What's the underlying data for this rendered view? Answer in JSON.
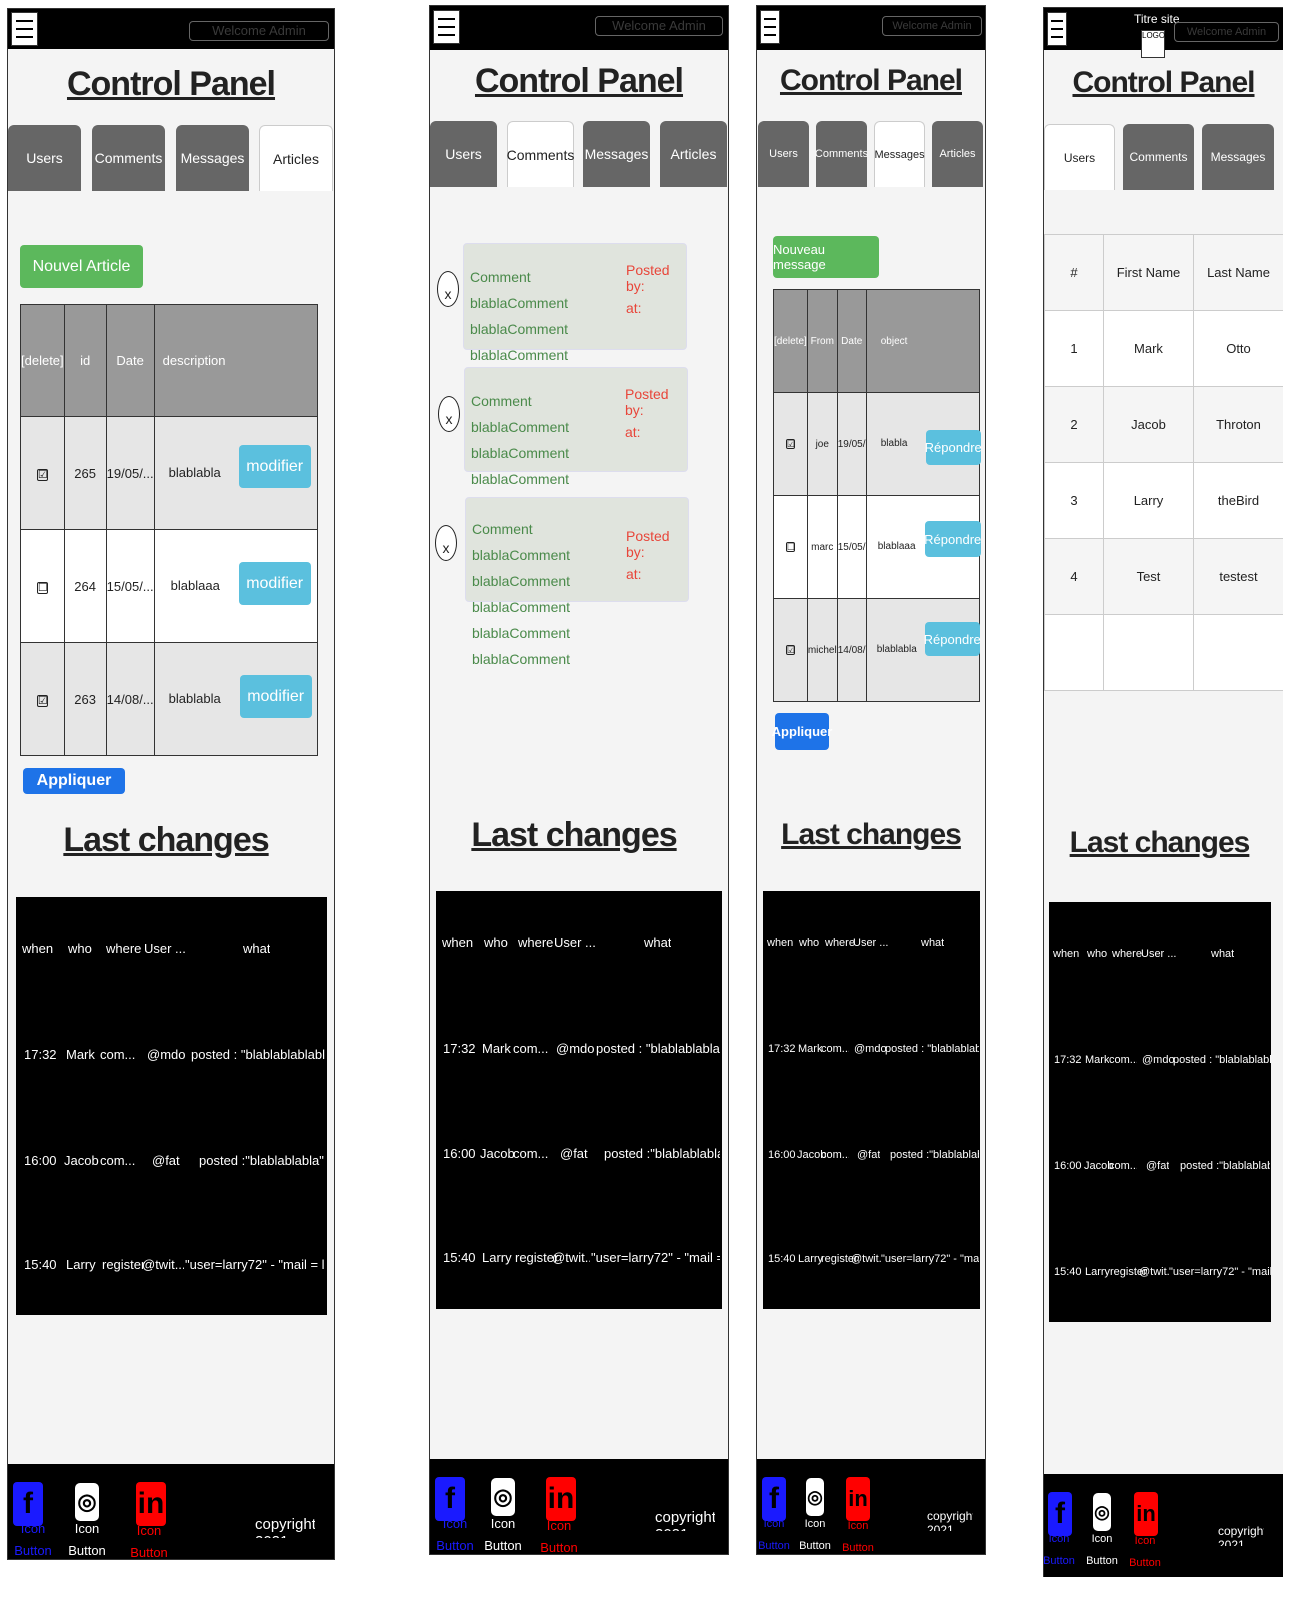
{
  "header": {
    "menu_icon": "hamburger-icon",
    "welcome": "Welcome Admin",
    "site_title": "Titre site",
    "logo": "LOGO"
  },
  "page_title": "Control Panel",
  "tabs": {
    "users": "Users",
    "comments": "Comments",
    "messages": "Messages",
    "articles": "Articles"
  },
  "articles": {
    "new_button": "Nouvel Article",
    "columns": [
      "[delete]",
      "id",
      "Date",
      "description"
    ],
    "rows": [
      {
        "checked": "☑",
        "id": "265",
        "date": "19/05/...",
        "description": "blablabla",
        "action": "modifier"
      },
      {
        "checked": "☐",
        "id": "264",
        "date": "15/05/...",
        "description": "blablaaa",
        "action": "modifier"
      },
      {
        "checked": "☑",
        "id": "263",
        "date": "14/08/...",
        "description": "blablabla",
        "action": "modifier"
      }
    ],
    "apply": "Appliquer"
  },
  "comments": {
    "items": [
      {
        "text": "Comment blablaComment blablaComment blablaComment blablaComment blablaComment",
        "posted_by": "Posted by:",
        "at": "at:",
        "delete": "x"
      },
      {
        "text": "Comment blablaComment blablaComment blablaComment blablaComment blablaComment",
        "posted_by": "Posted by:",
        "at": "at:",
        "delete": "x"
      },
      {
        "text": "Comment blablaComment blablaComment blablaComment blablaComment blablaComment",
        "posted_by": "Posted by:",
        "at": "at:",
        "delete": "x"
      }
    ]
  },
  "messages": {
    "new_button": "Nouveau message",
    "columns": [
      "[delete]",
      "From",
      "Date",
      "object"
    ],
    "rows": [
      {
        "checked": "☑",
        "from": "joe",
        "date": "19/05/...",
        "object": "blabla",
        "action": "Répondre"
      },
      {
        "checked": "☐",
        "from": "marc",
        "date": "15/05/...",
        "object": "blablaaa",
        "action": "Répondre"
      },
      {
        "checked": "☑",
        "from": "michel",
        "date": "14/08/...",
        "object": "blablabla",
        "action": "Répondre"
      }
    ],
    "apply": "Appliquer"
  },
  "users_table": {
    "columns": [
      "#",
      "First Name",
      "Last Name"
    ],
    "rows": [
      {
        "num": "1",
        "first": "Mark",
        "last": "Otto"
      },
      {
        "num": "2",
        "first": "Jacob",
        "last": "Throton"
      },
      {
        "num": "3",
        "first": "Larry",
        "last": "theBird"
      },
      {
        "num": "4",
        "first": "Test",
        "last": "testest"
      }
    ]
  },
  "last_changes": {
    "title": "Last changes",
    "columns": {
      "when": "when",
      "who": "who",
      "where": "where",
      "user": "User ...",
      "what": "what"
    },
    "rows": [
      {
        "when": "17:32",
        "who": "Mark",
        "where": "com...",
        "user": "@mdo",
        "what": "posted : \"blablablablabla\""
      },
      {
        "when": "16:00",
        "who": "Jacob",
        "where": "com...",
        "user": "@fat",
        "what": "posted :\"blablablabla\""
      },
      {
        "when": "15:40",
        "who": "Larry",
        "where": "register",
        "user": "@twit...",
        "what": "\"user=larry72\" - \"mail = la..."
      }
    ]
  },
  "footer": {
    "facebook_label": "Icon Button",
    "instagram_label": "Icon Button",
    "linkedin_label": "Icon Button",
    "copyright": "copyright-2021",
    "facebook_color": "#1a1aff",
    "linkedin_color": "#ff0000"
  }
}
